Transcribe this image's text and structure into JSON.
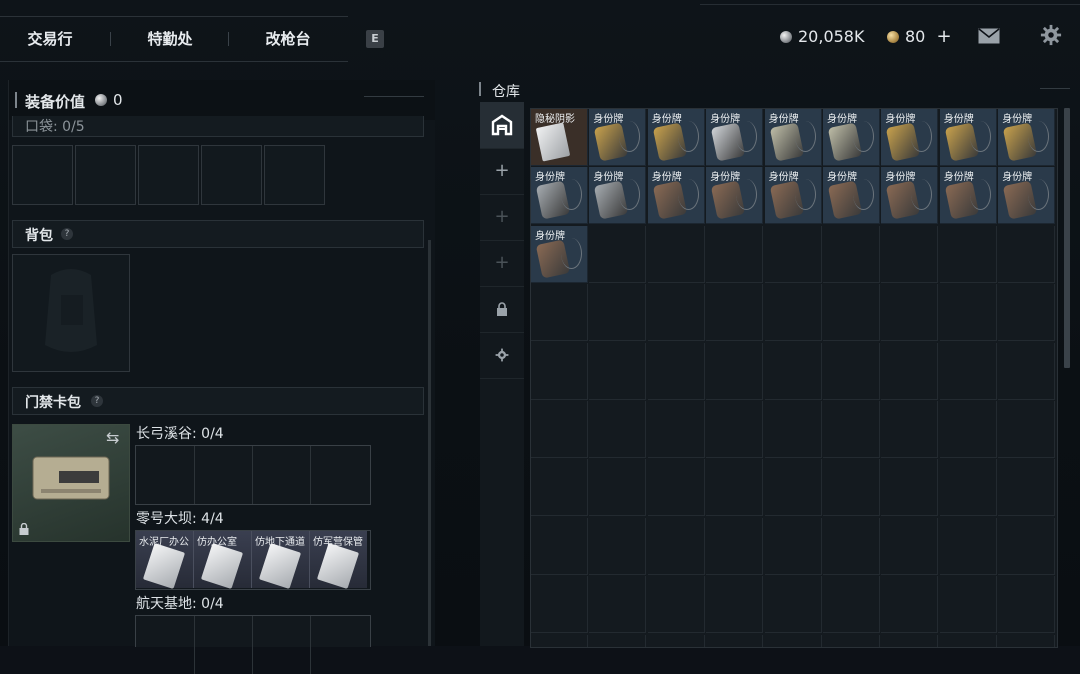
{
  "nav": {
    "tabs": [
      "交易行",
      "特勤处",
      "改枪台"
    ],
    "key_hint": "E"
  },
  "currency": {
    "silver": "20,058K",
    "gold": "80",
    "gold_add": "+"
  },
  "equipment": {
    "title": "装备价值",
    "value": "0",
    "pocket_label": "口袋: 0/5",
    "backpack_label": "背包",
    "keycard_label": "门禁卡包",
    "help": "?"
  },
  "keycard_sets": [
    {
      "label": "长弓溪谷: 0/4",
      "cards": []
    },
    {
      "label": "零号大坝: 4/4",
      "cards": [
        "水泥厂办公",
        "仿办公室",
        "仿地下通道",
        "仿军营保管"
      ]
    },
    {
      "label": "航天基地: 0/4",
      "cards": []
    }
  ],
  "warehouse": {
    "title": "仓库",
    "items": [
      {
        "label": "隐秘阴影",
        "kind": "special",
        "tone": "silver"
      },
      {
        "label": "身份牌",
        "kind": "tag",
        "tone": "gold"
      },
      {
        "label": "身份牌",
        "kind": "tag",
        "tone": "gold"
      },
      {
        "label": "身份牌",
        "kind": "tag",
        "tone": "silver"
      },
      {
        "label": "身份牌",
        "kind": "tag",
        "tone": "pale"
      },
      {
        "label": "身份牌",
        "kind": "tag",
        "tone": "pale"
      },
      {
        "label": "身份牌",
        "kind": "tag",
        "tone": "gold"
      },
      {
        "label": "身份牌",
        "kind": "tag",
        "tone": "gold"
      },
      {
        "label": "身份牌",
        "kind": "tag",
        "tone": "gold"
      },
      {
        "label": "身份牌",
        "kind": "tag",
        "tone": "steel"
      },
      {
        "label": "身份牌",
        "kind": "tag",
        "tone": "steel"
      },
      {
        "label": "身份牌",
        "kind": "tag",
        "tone": "bronze"
      },
      {
        "label": "身份牌",
        "kind": "tag",
        "tone": "bronze"
      },
      {
        "label": "身份牌",
        "kind": "tag",
        "tone": "bronze"
      },
      {
        "label": "身份牌",
        "kind": "tag",
        "tone": "bronze"
      },
      {
        "label": "身份牌",
        "kind": "tag",
        "tone": "bronze"
      },
      {
        "label": "身份牌",
        "kind": "tag",
        "tone": "bronze"
      },
      {
        "label": "身份牌",
        "kind": "tag",
        "tone": "bronze"
      },
      {
        "label": "身份牌",
        "kind": "tag",
        "tone": "bronze"
      }
    ]
  },
  "colors": {
    "gold": "#c9a24d",
    "silver": "#d2d6da",
    "pale": "#bfbea8",
    "steel": "#a7adb2",
    "bronze": "#8a6a54"
  }
}
